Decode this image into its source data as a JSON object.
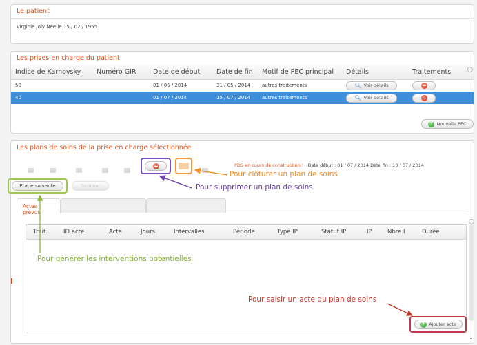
{
  "patient": {
    "title": "Le patient",
    "info": "Virginie Joly Née le 15 / 02 / 1955"
  },
  "pec": {
    "title": "Les prises en charge du patient",
    "columns": [
      "Indice de Karnovsky",
      "Numéro GIR",
      "Date de début",
      "Date de fin",
      "Motif de PEC principal",
      "Détails",
      "Traitements"
    ],
    "rows": [
      {
        "karnovsky": "50",
        "gir": "",
        "debut": "01 / 05 / 2014",
        "fin": "31 / 05 / 2014",
        "motif": "autres traitements",
        "details": "Voir détails"
      },
      {
        "karnovsky": "40",
        "gir": "",
        "debut": "01 / 07 / 2014",
        "fin": "15 / 07 / 2014",
        "motif": "autres traitements",
        "details": "Voir détails"
      }
    ],
    "new_button": "Nouvelle PEC",
    "selected_color": "#3d8fdc"
  },
  "plans": {
    "title": "Les plans de soins de la prise en charge sélectionnée",
    "status_label": "PDS en cours de construction !",
    "status_rest": "Date début : 01 / 07 / 2014  Date fin : 10 / 07 / 2014",
    "etape_button": "Etape suivante",
    "terminer_button": "Terminer",
    "tabs": [
      "Actes prévus",
      "",
      ""
    ],
    "columns": [
      "Trait.",
      "ID acte",
      "Acte",
      "Jours",
      "Intervalles",
      "Période",
      "Type IP",
      "Statut IP",
      "IP",
      "Nbre I",
      "Durée"
    ],
    "add_button": "Ajouter acte",
    "accent_color": "#e0501e"
  },
  "annotations": {
    "cloturer": "Pour clôturer un plan de soins",
    "supprimer": "Pour supprimer un plan de soins",
    "generer": "Pour générer les interventions potentielles",
    "saisir": "Pour saisir un acte du plan de soins"
  }
}
